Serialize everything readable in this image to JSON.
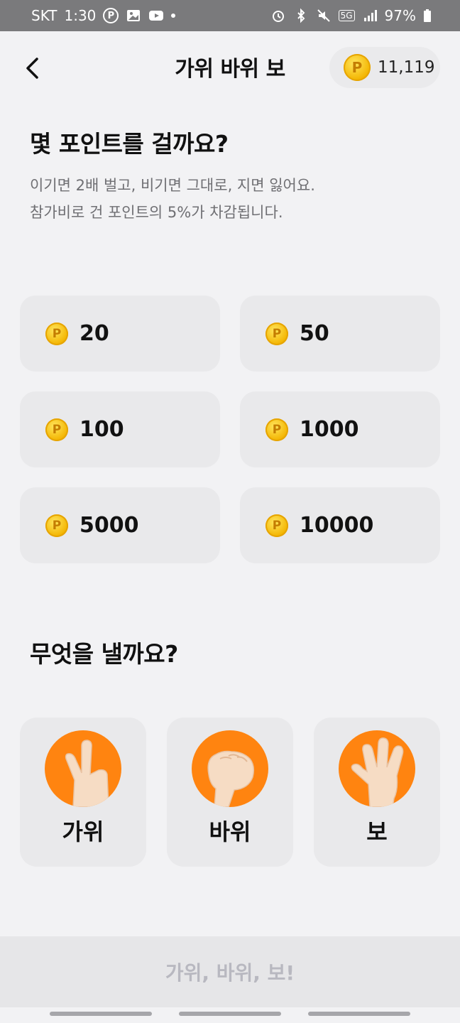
{
  "status_bar": {
    "carrier": "SKT",
    "time": "1:30",
    "network": "5G",
    "battery": "97%"
  },
  "header": {
    "title": "가위 바위 보",
    "balance": "11,119",
    "coin_symbol": "P"
  },
  "bet_section": {
    "title": "몇 포인트를 걸까요?",
    "desc_line1": "이기면 2배 벌고, 비기면 그대로, 지면 잃어요.",
    "desc_line2": "참가비로 건 포인트의 5%가 차감됩니다.",
    "options": [
      "20",
      "50",
      "100",
      "1000",
      "5000",
      "10000"
    ]
  },
  "choice_section": {
    "title": "무엇을 낼까요?",
    "choices": [
      {
        "label": "가위",
        "icon": "scissors-hand-icon"
      },
      {
        "label": "바위",
        "icon": "rock-fist-icon"
      },
      {
        "label": "보",
        "icon": "paper-hand-icon"
      }
    ]
  },
  "submit": {
    "label": "가위, 바위, 보!"
  },
  "colors": {
    "accent": "#ff8410",
    "coin": "#f3b400",
    "disabled_text": "#b8b8c0"
  }
}
